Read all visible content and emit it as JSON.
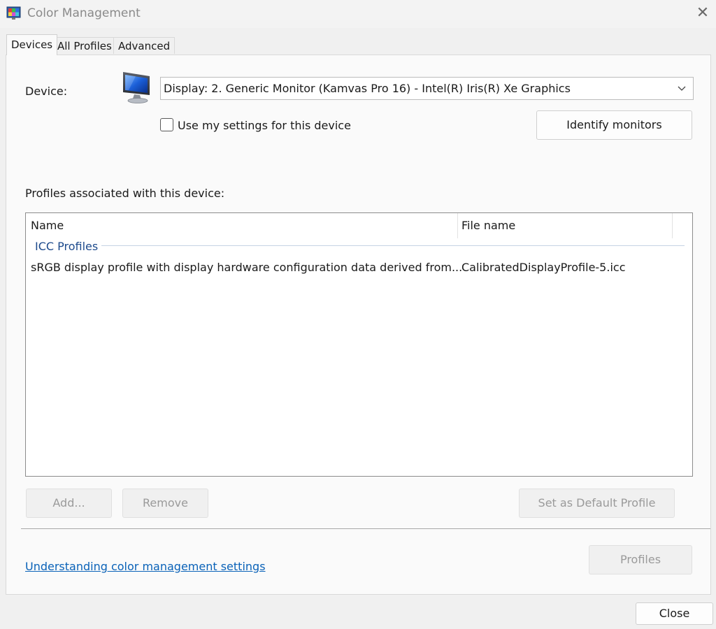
{
  "window": {
    "title": "Color Management",
    "icon": "color-management-app-icon",
    "close_icon": "close-icon"
  },
  "tabs": [
    {
      "label": "Devices",
      "active": true
    },
    {
      "label": "All Profiles",
      "active": false
    },
    {
      "label": "Advanced",
      "active": false
    }
  ],
  "devices": {
    "device_label": "Device:",
    "device_icon": "monitor-icon",
    "device_value": "Display: 2. Generic Monitor (Kamvas Pro 16) - Intel(R) Iris(R) Xe Graphics",
    "use_settings_label": "Use my settings for this device",
    "use_settings_checked": false,
    "identify_button": "Identify monitors",
    "profiles_label": "Profiles associated with this device:",
    "columns": [
      "Name",
      "File name"
    ],
    "group_label": "ICC Profiles",
    "rows": [
      {
        "name": "sRGB display profile with display hardware configuration data derived from...",
        "file": "CalibratedDisplayProfile-5.icc"
      }
    ],
    "add_button": "Add...",
    "remove_button": "Remove",
    "set_default_button": "Set as Default Profile",
    "profiles_button": "Profiles",
    "help_link": "Understanding color management settings"
  },
  "footer": {
    "close_button": "Close"
  },
  "colors": {
    "link": "#0a62b8",
    "group_header": "#1d4a8c",
    "disabled_text": "#9a9a9a"
  }
}
